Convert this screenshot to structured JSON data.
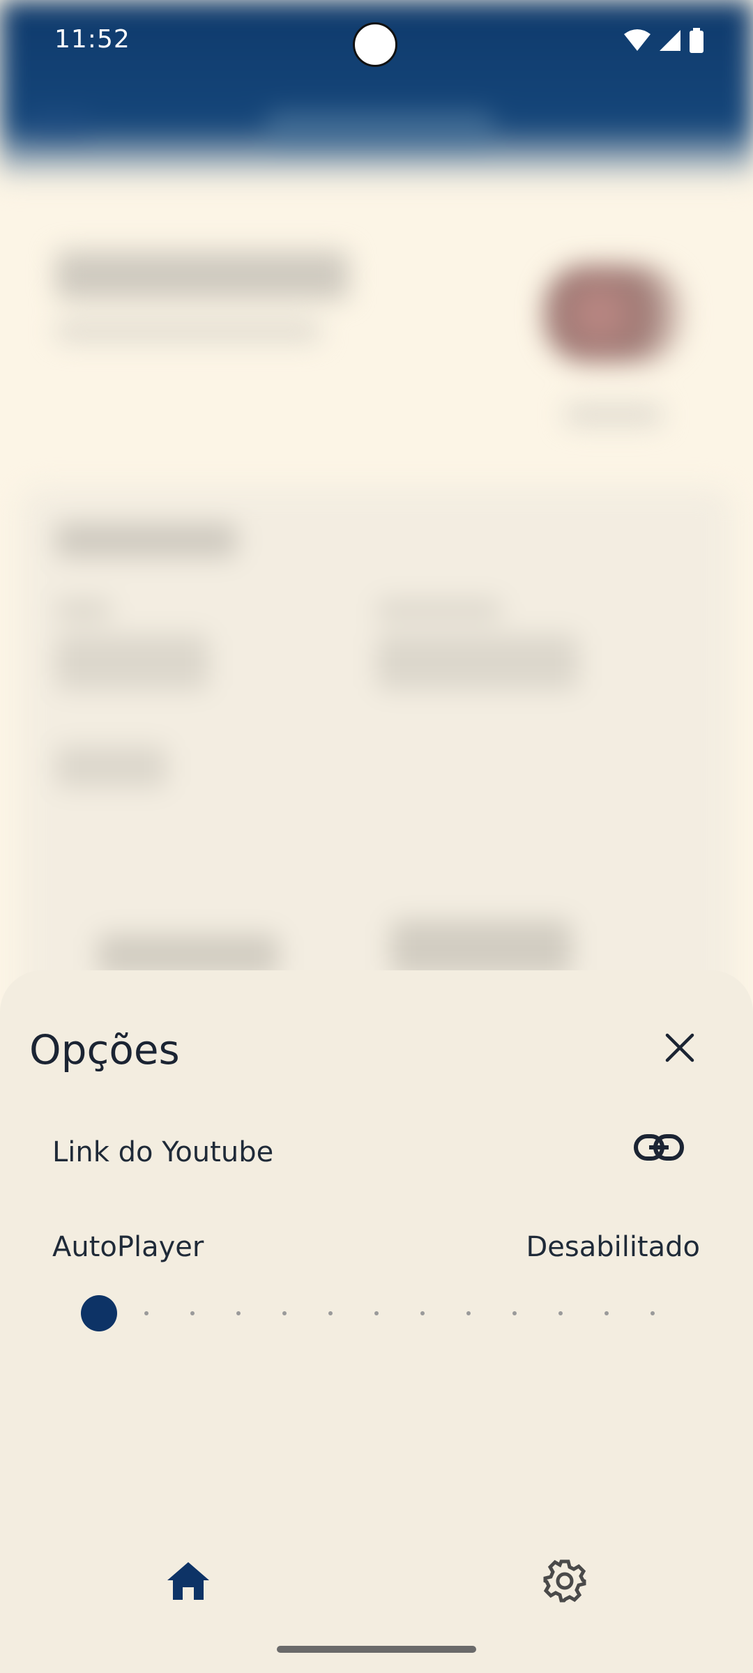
{
  "status_bar": {
    "time": "11:52",
    "icons": [
      "wifi-icon",
      "signal-icon",
      "battery-icon"
    ]
  },
  "sheet": {
    "title": "Opções",
    "close_icon": "close-icon",
    "youtube_link": {
      "label": "Link do Youtube",
      "icon": "link-icon"
    },
    "autoplayer": {
      "label": "AutoPlayer",
      "value": "Desabilitado",
      "slider_position": 0,
      "slider_steps": 13
    }
  },
  "bottom_nav": {
    "items": [
      {
        "icon": "home-icon",
        "active": true
      },
      {
        "icon": "gear-icon",
        "active": false
      }
    ]
  },
  "colors": {
    "primary": "#0d3366",
    "sheet_bg": "#f3ede0",
    "text": "#1f2a38"
  }
}
